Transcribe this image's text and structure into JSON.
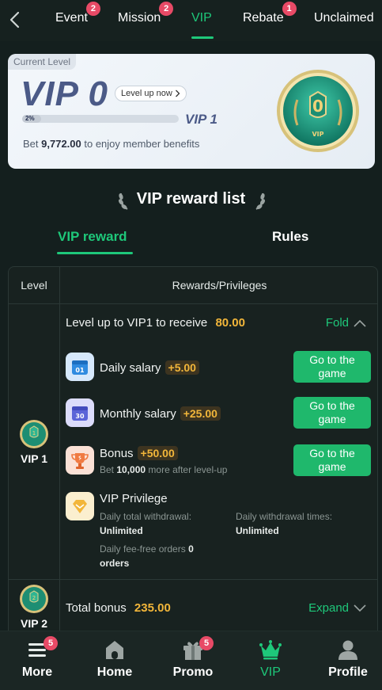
{
  "topnav": {
    "tabs": [
      {
        "label": "Event",
        "badge": "2"
      },
      {
        "label": "Mission",
        "badge": "2"
      },
      {
        "label": "VIP",
        "badge": null,
        "active": true
      },
      {
        "label": "Rebate",
        "badge": "1"
      },
      {
        "label": "Unclaimed",
        "badge": null
      }
    ]
  },
  "level_card": {
    "tag": "Current Level",
    "current_vip": "VIP 0",
    "level_up_label": "Level up now",
    "progress_label": "2%",
    "progress_fraction": 0.02,
    "next_vip": "VIP 1",
    "bet_prefix": "Bet",
    "bet_amount": "9,772.00",
    "bet_suffix": "to enjoy member benefits",
    "medal_digit": "0",
    "medal_caption": "VIP"
  },
  "reward_list": {
    "title": "VIP reward list",
    "subtabs": [
      "VIP reward",
      "Rules"
    ],
    "headers": {
      "level": "Level",
      "rewards": "Rewards/Privileges"
    }
  },
  "vip1": {
    "level": "VIP 1",
    "medal_digit": "1",
    "receive_text": "Level up to VIP1 to receive",
    "receive_amount": "80.00",
    "fold_label": "Fold",
    "rewards": [
      {
        "name": "Daily salary",
        "amount": "+5.00",
        "button": "Go to the game",
        "icon": "calendar-01-icon",
        "icon_text": "01"
      },
      {
        "name": "Monthly salary",
        "amount": "+25.00",
        "button": "Go to the game",
        "icon": "calendar-30-icon",
        "icon_text": "30"
      },
      {
        "name": "Bonus",
        "amount": "+50.00",
        "button": "Go to the game",
        "icon": "trophy-icon",
        "sub_prefix": "Bet",
        "sub_amount": "10,000",
        "sub_suffix": "more after level-up"
      }
    ],
    "privilege": {
      "title": "VIP Privilege",
      "withdrawal_label": "Daily total withdrawal:",
      "withdrawal_value": "Unlimited",
      "times_label": "Daily withdrawal times:",
      "times_value": "Unlimited",
      "fee_free_label": "Daily fee-free orders",
      "fee_free_value": "0",
      "fee_free_unit": "orders"
    }
  },
  "vip2": {
    "level": "VIP 2",
    "medal_digit": "2",
    "total_label": "Total bonus",
    "total_amount": "235.00",
    "expand_label": "Expand"
  },
  "bottomnav": {
    "items": [
      {
        "label": "More",
        "badge": "5",
        "icon": "menu-icon"
      },
      {
        "label": "Home",
        "badge": null,
        "icon": "home-icon"
      },
      {
        "label": "Promo",
        "badge": "5",
        "icon": "gift-icon"
      },
      {
        "label": "VIP",
        "badge": null,
        "icon": "crown-icon",
        "active": true
      },
      {
        "label": "Profile",
        "badge": null,
        "icon": "profile-icon"
      }
    ]
  },
  "colors": {
    "accent": "#1ec87a",
    "gold": "#f2b63a",
    "badge": "#e84a66",
    "background": "#141f1e"
  }
}
